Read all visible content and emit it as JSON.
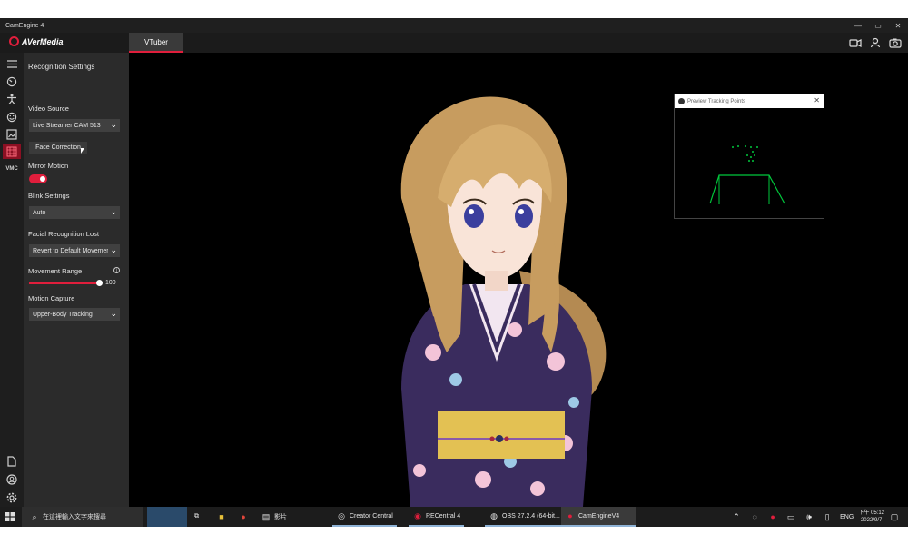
{
  "window": {
    "title": "CamEngine 4",
    "controls": [
      "—",
      "▭",
      "✕"
    ]
  },
  "app": {
    "brand": "AVerMedia",
    "tab": "VTuber",
    "top_icons": [
      "camera-icon",
      "person-icon",
      "photo-camera-icon"
    ]
  },
  "rail": {
    "items": [
      "menu-icon",
      "face-icon",
      "body-icon",
      "smile-icon",
      "image-icon",
      "tracking-icon",
      "VMC"
    ],
    "bottom": [
      "document-icon",
      "account-icon",
      "settings-icon"
    ]
  },
  "panel": {
    "heading": "Recognition Settings",
    "video_source_label": "Video Source",
    "video_source_value": "Live Streamer CAM 513",
    "face_correction_button": "Face Correction",
    "mirror_motion_label": "Mirror Motion",
    "mirror_motion_on": true,
    "blink_label": "Blink Settings",
    "blink_value": "Auto",
    "lost_label": "Facial Recognition Lost",
    "lost_value": "Revert to Default Movement",
    "movement_label": "Movement Range",
    "movement_value": "100",
    "motion_label": "Motion Capture",
    "motion_value": "Upper-Body Tracking"
  },
  "preview": {
    "title": "Preview Tracking Points"
  },
  "taskbar": {
    "search_placeholder": "在這裡輸入文字來搜尋",
    "pinned": [
      "影片"
    ],
    "apps": [
      "Creator Central",
      "RECentral 4",
      "OBS 27.2.4 (64-bit...",
      "CamEngineV4"
    ],
    "lang": "ENG",
    "time": "下午 05:12",
    "date": "2022/9/7"
  },
  "colors": {
    "accent": "#e01e3c",
    "panel": "#2b2b2b",
    "rail": "#1e1e1e",
    "tracking": "#00c83c"
  }
}
